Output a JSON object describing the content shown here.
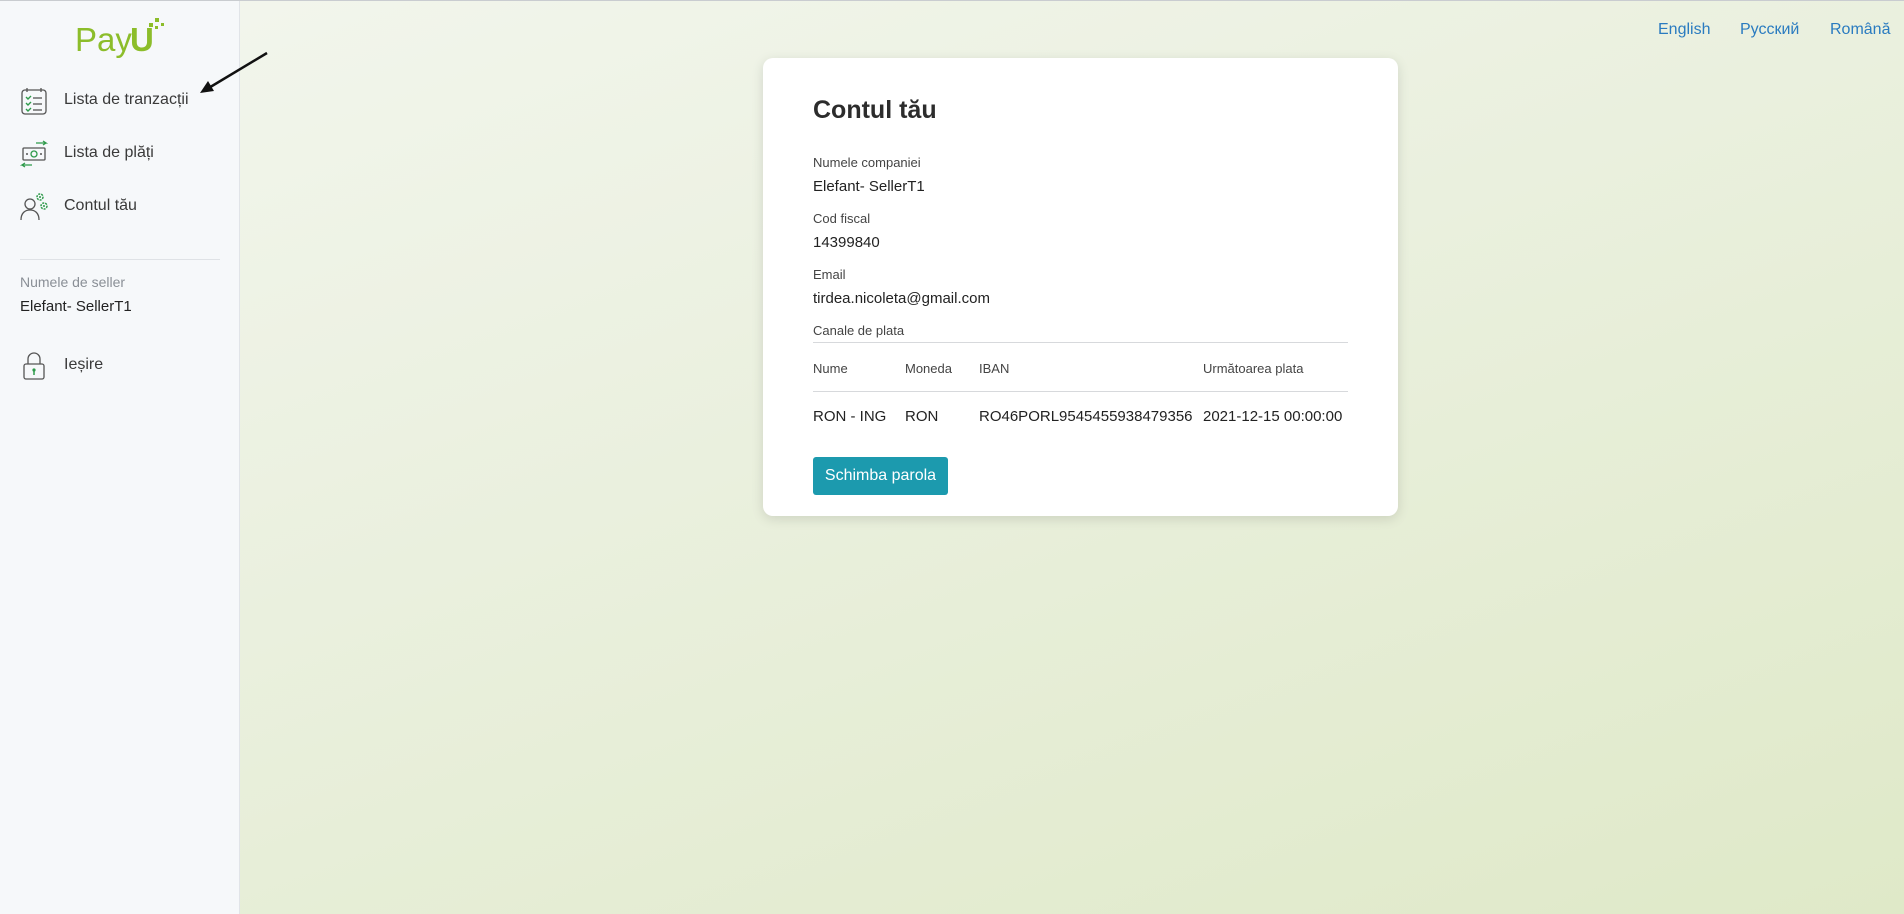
{
  "brand": {
    "logo_text": "PayU",
    "accent": "#8cbd2a"
  },
  "languages": [
    {
      "label": "English"
    },
    {
      "label": "Русский"
    },
    {
      "label": "Română"
    }
  ],
  "sidebar": {
    "items": [
      {
        "label": "Lista de tranzacții",
        "icon": "checklist-icon"
      },
      {
        "label": "Lista de plăți",
        "icon": "money-transfer-icon"
      },
      {
        "label": "Contul tău",
        "icon": "user-settings-icon"
      }
    ],
    "seller_caption": "Numele de seller",
    "seller_name": "Elefant- SellerT1",
    "logout_label": "Ieșire"
  },
  "account": {
    "title": "Contul tău",
    "company_label": "Numele companiei",
    "company_value": "Elefant- SellerT1",
    "fiscal_label": "Cod fiscal",
    "fiscal_value": "14399840",
    "email_label": "Email",
    "email_value": "tirdea.nicoleta@gmail.com",
    "channels_label": "Canale de plata",
    "table": {
      "headers": [
        "Nume",
        "Moneda",
        "IBAN",
        "Următoarea plata"
      ],
      "rows": [
        [
          "RON - ING",
          "RON",
          "RO46PORL9545455938479356",
          "2021-12-15 00:00:00"
        ]
      ]
    },
    "change_password_label": "Schimba parola",
    "button_color": "#1c9aae"
  }
}
